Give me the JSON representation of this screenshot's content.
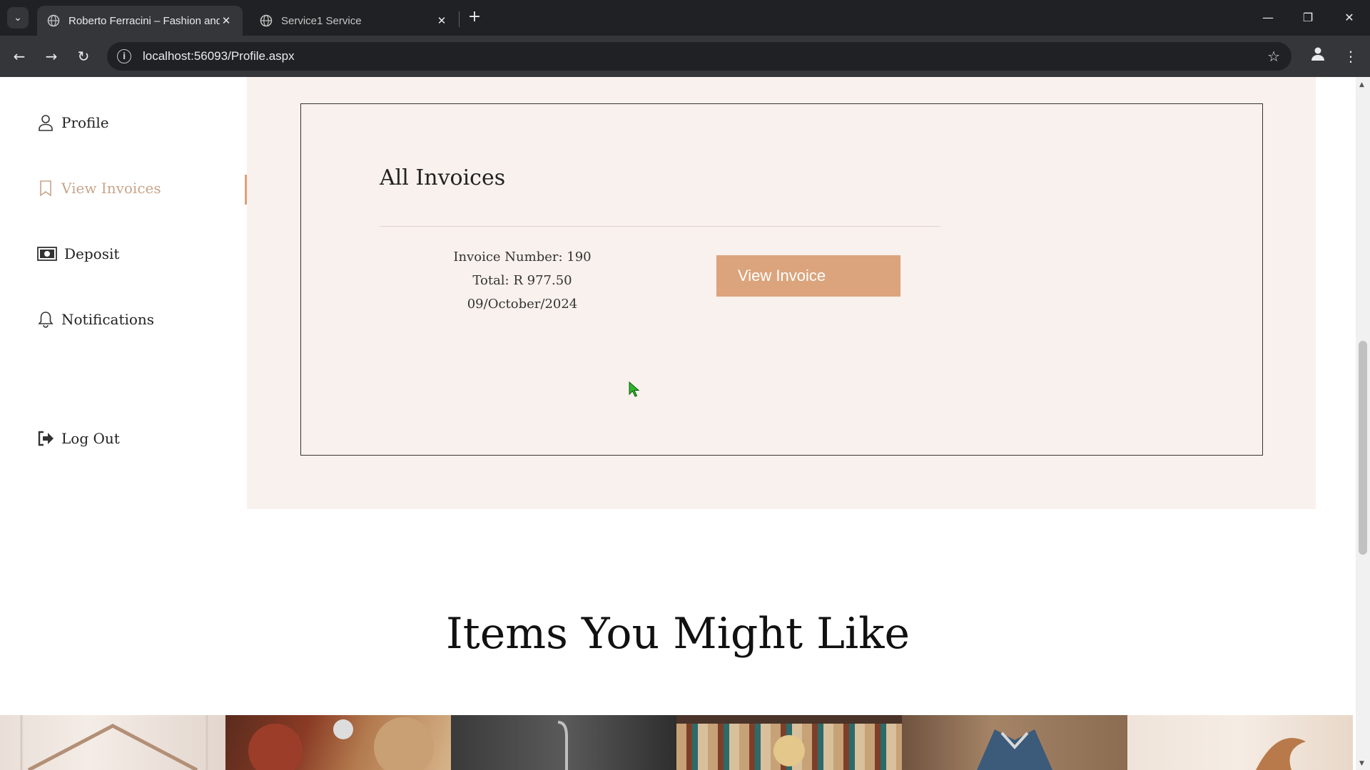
{
  "browser": {
    "tabs": [
      {
        "title": "Roberto Ferracini – Fashion and",
        "active": true
      },
      {
        "title": "Service1 Service",
        "active": false
      }
    ],
    "url": "localhost:56093/Profile.aspx"
  },
  "sidebar": {
    "items": [
      {
        "label": "Profile",
        "icon": "user-icon"
      },
      {
        "label": "View Invoices",
        "icon": "bookmark-icon",
        "active": true
      },
      {
        "label": "Deposit",
        "icon": "money-icon"
      },
      {
        "label": "Notifications",
        "icon": "bell-icon"
      },
      {
        "label": "Log Out",
        "icon": "logout-icon"
      }
    ]
  },
  "invoices": {
    "title": "All Invoices",
    "items": [
      {
        "number_text": "Invoice Number: 190",
        "total_text": "Total: R 977.50",
        "date_text": "09/October/2024",
        "button_label": "View Invoice"
      }
    ]
  },
  "recommended": {
    "title": "Items You Might Like"
  },
  "colors": {
    "accent": "#dba47c",
    "panel_bg": "#f9f1ed",
    "active_text": "#c8a58a"
  }
}
